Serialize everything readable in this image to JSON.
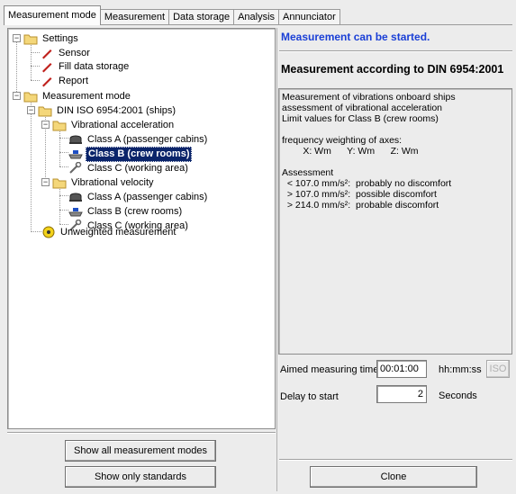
{
  "tabs": [
    {
      "label": "Measurement mode",
      "active": true
    },
    {
      "label": "Measurement"
    },
    {
      "label": "Data storage"
    },
    {
      "label": "Analysis"
    },
    {
      "label": "Annunciator"
    }
  ],
  "tree": {
    "settings": "Settings",
    "sensor": "Sensor",
    "fill_data_storage": "Fill data storage",
    "report": "Report",
    "measurement_mode": "Measurement mode",
    "din": "DIN ISO 6954:2001 (ships)",
    "vib_accel": "Vibrational acceleration",
    "a_class_a": "Class A (passenger cabins)",
    "a_class_b": "Class B (crew rooms)",
    "a_class_c": "Class C (working area)",
    "vib_vel": "Vibrational velocity",
    "v_class_a": "Class A (passenger cabins)",
    "v_class_b": "Class B (crew rooms)",
    "v_class_c": "Class C (working area)",
    "unweighted": "Unweighted measurement",
    "selected": "a_class_b"
  },
  "status": {
    "text": "Measurement can be started.",
    "color": "#1a3fd6"
  },
  "heading": "Measurement according to DIN 6954:2001",
  "description": [
    "Measurement of vibrations onboard ships",
    "assessment of vibrational acceleration",
    "Limit values for Class B (crew rooms)",
    "",
    "frequency weighting of axes:",
    "        X: Wm      Y: Wm      Z: Wm",
    "",
    "Assessment",
    "  < 107.0 mm/s²:  probably no discomfort",
    "  > 107.0 mm/s²:  possible discomfort",
    "  > 214.0 mm/s²:  probable discomfort"
  ],
  "aimed_time": {
    "label": "Aimed measuring time",
    "value": "00:01:00",
    "unit": "hh:mm:ss",
    "iso_label": "ISO"
  },
  "delay": {
    "label": "Delay to start",
    "value": "2",
    "unit": "Seconds"
  },
  "buttons": {
    "show_all": "Show all measurement modes",
    "show_standards": "Show only standards",
    "clone": "Clone"
  },
  "icons": [
    "folder-icon",
    "wrench-icon",
    "cabin-icon",
    "ship-icon",
    "unweighted-icon"
  ]
}
